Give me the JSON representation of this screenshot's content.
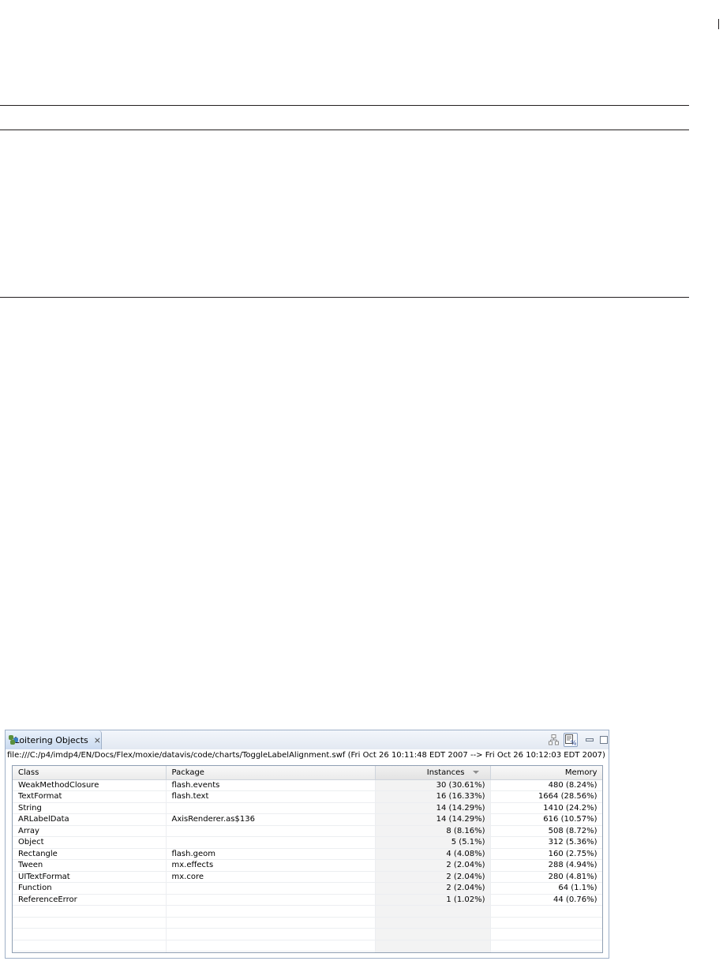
{
  "view": {
    "tab_label": "Loitering Objects",
    "file_path": "file:///C:/p4/imdp4/EN/Docs/Flex/moxie/datavis/code/charts/ToggleLabelAlignment.swf (Fri Oct 26 10:11:48 EDT 2007 --> Fri Oct 26 10:12:03 EDT 2007)"
  },
  "table": {
    "headers": {
      "class": "Class",
      "package": "Package",
      "instances": "Instances",
      "memory": "Memory"
    },
    "rows": [
      {
        "class": "WeakMethodClosure",
        "package": "flash.events",
        "instances": "30 (30.61%)",
        "memory": "480 (8.24%)"
      },
      {
        "class": "TextFormat",
        "package": "flash.text",
        "instances": "16 (16.33%)",
        "memory": "1664 (28.56%)"
      },
      {
        "class": "String",
        "package": "",
        "instances": "14 (14.29%)",
        "memory": "1410 (24.2%)"
      },
      {
        "class": "ARLabelData",
        "package": "AxisRenderer.as$136",
        "instances": "14 (14.29%)",
        "memory": "616 (10.57%)"
      },
      {
        "class": "Array",
        "package": "",
        "instances": "8 (8.16%)",
        "memory": "508 (8.72%)"
      },
      {
        "class": "Object",
        "package": "",
        "instances": "5 (5.1%)",
        "memory": "312 (5.36%)"
      },
      {
        "class": "Rectangle",
        "package": "flash.geom",
        "instances": "4 (4.08%)",
        "memory": "160 (2.75%)"
      },
      {
        "class": "Tween",
        "package": "mx.effects",
        "instances": "2 (2.04%)",
        "memory": "288 (4.94%)"
      },
      {
        "class": "UITextFormat",
        "package": "mx.core",
        "instances": "2 (2.04%)",
        "memory": "280 (4.81%)"
      },
      {
        "class": "Function",
        "package": "",
        "instances": "2 (2.04%)",
        "memory": "64 (1.1%)"
      },
      {
        "class": "ReferenceError",
        "package": "",
        "instances": "1 (1.02%)",
        "memory": "44 (0.76%)"
      }
    ]
  }
}
